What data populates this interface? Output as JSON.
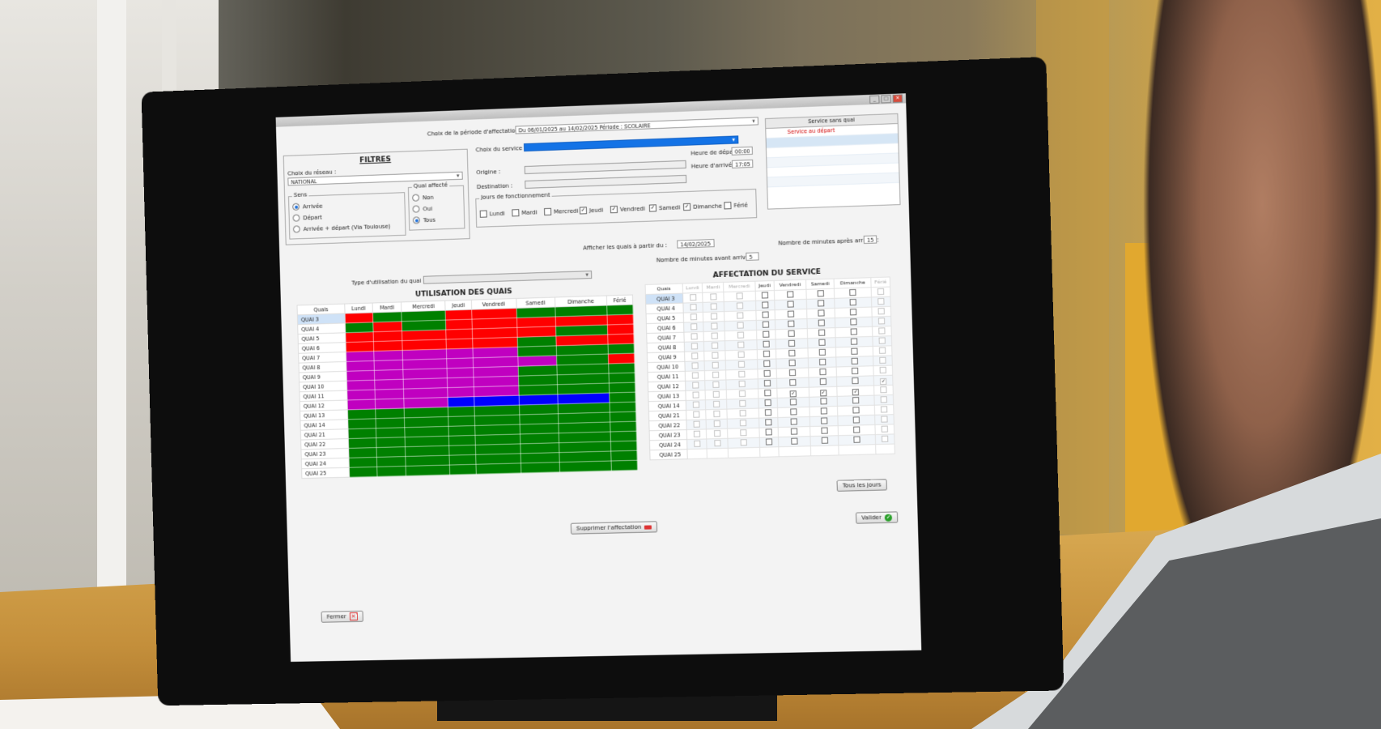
{
  "window": {
    "buttons": [
      "_",
      "□",
      "✕"
    ]
  },
  "period": {
    "label": "Choix de la période d'affectation",
    "value": "Du 06/01/2025 au 14/02/2025 Période : SCOLAIRE"
  },
  "filters": {
    "title": "FILTRES",
    "network_label": "Choix du réseau :",
    "network_value": "NATIONAL",
    "sens_title": "Sens",
    "sens_options": [
      "Arrivée",
      "Départ",
      "Arrivée + départ (Via Toulouse)"
    ],
    "sens_selected": 0,
    "quai_title": "Quai affecté",
    "quai_options": [
      "Non",
      "Oui",
      "Tous"
    ],
    "quai_selected": 2
  },
  "service": {
    "choix_label": "Choix du service :",
    "origine_label": "Origine :",
    "destination_label": "Destination :",
    "heure_depart_label": "Heure de départ :",
    "heure_depart_value": "00:00",
    "heure_arrivee_label": "Heure d'arrivée :",
    "heure_arrivee_value": "17:05",
    "jours_title": "Jours de fonctionnement",
    "days": [
      {
        "label": "Lundi",
        "checked": false
      },
      {
        "label": "Mardi",
        "checked": false
      },
      {
        "label": "Mercredi",
        "checked": false
      },
      {
        "label": "Jeudi",
        "checked": true
      },
      {
        "label": "Vendredi",
        "checked": true
      },
      {
        "label": "Samedi",
        "checked": true
      },
      {
        "label": "Dimanche",
        "checked": true
      },
      {
        "label": "Férié",
        "checked": false
      }
    ]
  },
  "service_panel": {
    "header": "Service sans quai",
    "item": "Service au départ"
  },
  "options": {
    "afficher_label": "Afficher les quais à partir du :",
    "afficher_value": "14/02/2025",
    "minutes_avant_label": "Nombre de minutes avant arrivée :",
    "minutes_avant_value": "5",
    "minutes_apres_label": "Nombre de minutes après arrivée :",
    "minutes_apres_value": "15",
    "type_label": "Type d'utilisation du quai :"
  },
  "utilisation": {
    "title": "UTILISATION DES QUAIS",
    "columns": [
      "Quais",
      "Lundi",
      "Mardi",
      "Mercredi",
      "Jeudi",
      "Vendredi",
      "Samedi",
      "Dimanche",
      "Férié"
    ],
    "rows": [
      "QUAI 3",
      "QUAI 4",
      "QUAI 5",
      "QUAI 6",
      "QUAI 7",
      "QUAI 8",
      "QUAI 9",
      "QUAI 10",
      "QUAI 11",
      "QUAI 12",
      "QUAI 13",
      "QUAI 14",
      "QUAI 21",
      "QUAI 22",
      "QUAI 23",
      "QUAI 24",
      "QUAI 25"
    ],
    "colors": {
      "R": "#ff0000",
      "G": "#008000",
      "M": "#c000c0",
      "B": "#0000ff"
    },
    "cells": [
      [
        "R",
        "G",
        "G",
        "R",
        "R",
        "G",
        "G",
        "G"
      ],
      [
        "G",
        "R",
        "G",
        "R",
        "R",
        "R",
        "R",
        "R"
      ],
      [
        "R",
        "R",
        "R",
        "R",
        "R",
        "R",
        "G",
        "R"
      ],
      [
        "R",
        "R",
        "R",
        "R",
        "R",
        "G",
        "R",
        "R"
      ],
      [
        "M",
        "M",
        "M",
        "M",
        "M",
        "G",
        "G",
        "G"
      ],
      [
        "M",
        "M",
        "M",
        "M",
        "M",
        "M",
        "G",
        "R"
      ],
      [
        "M",
        "M",
        "M",
        "M",
        "M",
        "G",
        "G",
        "G"
      ],
      [
        "M",
        "M",
        "M",
        "M",
        "M",
        "G",
        "G",
        "G"
      ],
      [
        "M",
        "M",
        "M",
        "M",
        "M",
        "G",
        "G",
        "G"
      ],
      [
        "M",
        "M",
        "M",
        "B",
        "B",
        "B",
        "B",
        "G"
      ],
      [
        "G",
        "G",
        "G",
        "G",
        "G",
        "G",
        "G",
        "G"
      ],
      [
        "G",
        "G",
        "G",
        "G",
        "G",
        "G",
        "G",
        "G"
      ],
      [
        "G",
        "G",
        "G",
        "G",
        "G",
        "G",
        "G",
        "G"
      ],
      [
        "G",
        "G",
        "G",
        "G",
        "G",
        "G",
        "G",
        "G"
      ],
      [
        "G",
        "G",
        "G",
        "G",
        "G",
        "G",
        "G",
        "G"
      ],
      [
        "G",
        "G",
        "G",
        "G",
        "G",
        "G",
        "G",
        "G"
      ],
      [
        "G",
        "G",
        "G",
        "G",
        "G",
        "G",
        "G",
        "G"
      ]
    ]
  },
  "affectation": {
    "title": "AFFECTATION DU SERVICE",
    "columns": [
      "Quais",
      "Lundi",
      "Mardi",
      "Mercredi",
      "Jeudi",
      "Vendredi",
      "Samedi",
      "Dimanche",
      "Férié"
    ],
    "rows": [
      "QUAI 3",
      "QUAI 4",
      "QUAI 5",
      "QUAI 6",
      "QUAI 7",
      "QUAI 8",
      "QUAI 9",
      "QUAI 10",
      "QUAI 11",
      "QUAI 12",
      "QUAI 13",
      "QUAI 14",
      "QUAI 21",
      "QUAI 22",
      "QUAI 23",
      "QUAI 24",
      "QUAI 25"
    ],
    "checked": [
      [
        10,
        4
      ],
      [
        10,
        5
      ],
      [
        10,
        6
      ],
      [
        9,
        7
      ]
    ]
  },
  "buttons": {
    "tous_les_jours": "Tous les jours",
    "supprimer": "Supprimer l'affectation",
    "valider": "Valider",
    "fermer": "Fermer"
  }
}
